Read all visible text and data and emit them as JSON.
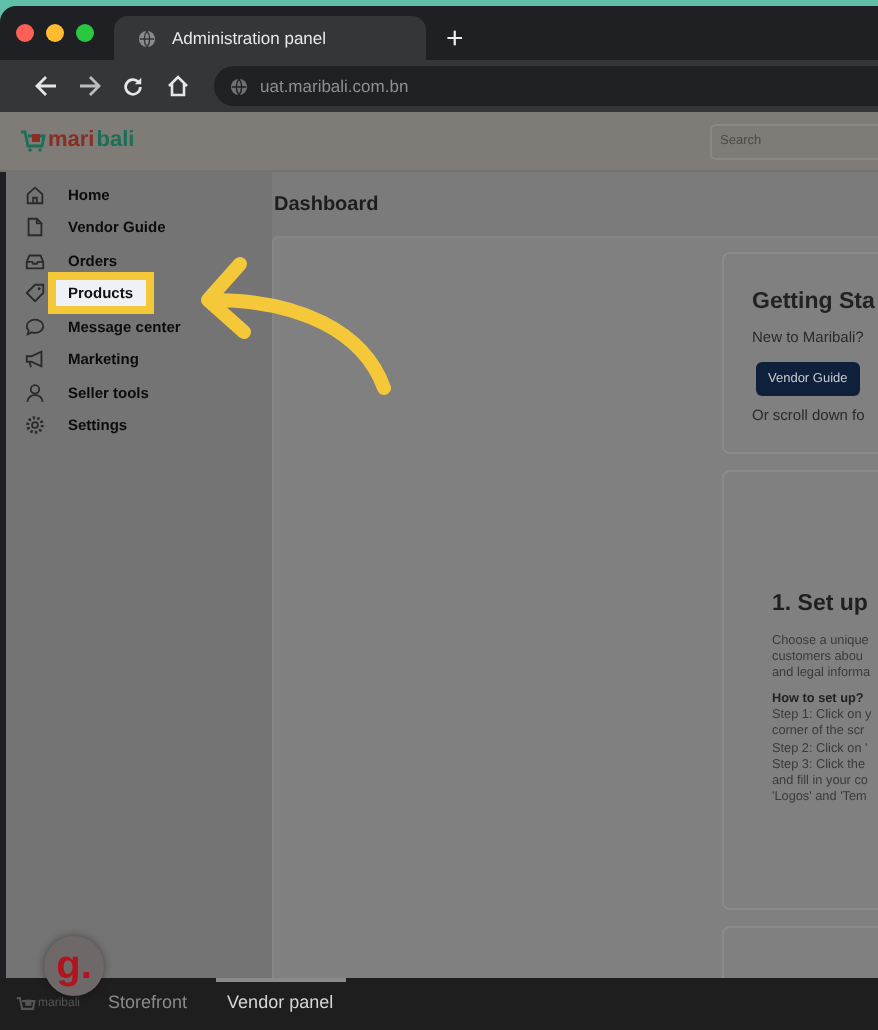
{
  "browser": {
    "tab_title": "Administration panel",
    "new_tab": "+",
    "url": "uat.maribali.com.bn"
  },
  "header": {
    "logo": {
      "part_1": "mari",
      "part_2": "bali"
    },
    "search": {
      "placeholder": "Search"
    }
  },
  "sidebar": {
    "items": [
      {
        "label": "Home",
        "highlighted": false
      },
      {
        "label": "Vendor Guide",
        "highlighted": false
      },
      {
        "label": "Orders",
        "highlighted": false
      },
      {
        "label": "Products",
        "highlighted": true
      },
      {
        "label": "Message center",
        "highlighted": false
      },
      {
        "label": "Marketing",
        "highlighted": false
      },
      {
        "label": "Seller tools",
        "highlighted": false
      },
      {
        "label": "Settings",
        "highlighted": false
      }
    ]
  },
  "page_title": "Dashboard",
  "getting_started": {
    "title": "Getting Sta",
    "text": "New to Maribali?",
    "button": "Vendor Guide",
    "note": "Or scroll down fo"
  },
  "setup": {
    "title": "1. Set up",
    "intro": [
      "Choose a unique",
      "customers abou",
      "and legal informa"
    ],
    "how_title": "How to set up?",
    "steps": [
      "Step 1: Click on y",
      "corner of the scr",
      "Step 2: Click on '",
      "Step 3: Click the",
      "and fill in your co",
      "'Logos' and 'Tem"
    ]
  },
  "chat_widget": {
    "letter": "g."
  },
  "bottom_bar": {
    "logo": "maribali",
    "tabs": [
      {
        "label": "Storefront",
        "selected": false
      },
      {
        "label": "Vendor panel",
        "selected": true
      }
    ]
  }
}
